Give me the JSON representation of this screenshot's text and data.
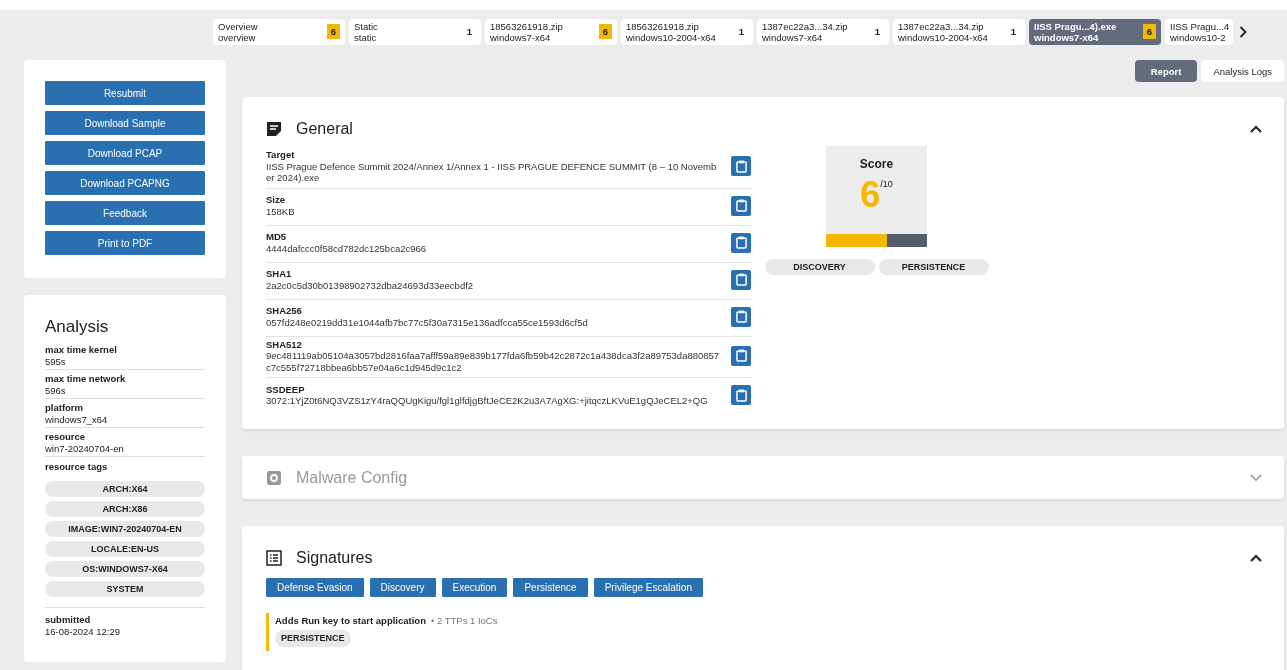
{
  "tabs": [
    {
      "title": "Overview",
      "subtitle": "overview",
      "count": "6",
      "kind": "score",
      "selected": false
    },
    {
      "title": "Static",
      "subtitle": "static",
      "count": "1",
      "kind": "plain",
      "selected": false
    },
    {
      "title": "18563261918.zip",
      "subtitle": "windows7-x64",
      "count": "6",
      "kind": "score",
      "selected": false
    },
    {
      "title": "18563261918.zip",
      "subtitle": "windows10-2004-x64",
      "count": "1",
      "kind": "plain",
      "selected": false
    },
    {
      "title": "1387ec22a3...34.zip",
      "subtitle": "windows7-x64",
      "count": "1",
      "kind": "plain",
      "selected": false
    },
    {
      "title": "1387ec22a3...34.zip",
      "subtitle": "windows10-2004-x64",
      "count": "1",
      "kind": "plain",
      "selected": false
    },
    {
      "title": "IISS Pragu...4).exe",
      "subtitle": "windows7-x64",
      "count": "6",
      "kind": "score",
      "selected": true
    },
    {
      "title": "IISS Pragu...4",
      "subtitle": "windows10-2",
      "selected": false
    }
  ],
  "view_buttons": [
    {
      "label": "Report",
      "selected": true
    },
    {
      "label": "Analysis Logs",
      "selected": false
    }
  ],
  "actions": [
    "Resubmit",
    "Download Sample",
    "Download PCAP",
    "Download PCAPNG",
    "Feedback",
    "Print to PDF"
  ],
  "analysis": {
    "title": "Analysis",
    "fields": [
      {
        "label": "max time kernel",
        "value": "595s"
      },
      {
        "label": "max time network",
        "value": "596s"
      },
      {
        "label": "platform",
        "value": "windows7_x64"
      },
      {
        "label": "resource",
        "value": "win7-20240704-en"
      }
    ],
    "tags_label": "resource tags",
    "tags": [
      "ARCH:X64",
      "ARCH:X86",
      "IMAGE:WIN7-20240704-EN",
      "LOCALE:EN-US",
      "OS:WINDOWS7-X64",
      "SYSTEM"
    ],
    "submitted": {
      "label": "submitted",
      "value": "16-08-2024 12:29"
    }
  },
  "general": {
    "title": "General",
    "expanded": true,
    "fields": [
      {
        "label": "Target",
        "value": "IISS Prague Defence Summit 2024/Annex 1/Annex 1 - IISS PRAGUE DEFENCE SUMMIT (8 – 10 November 2024).exe"
      },
      {
        "label": "Size",
        "value": "158KB"
      },
      {
        "label": "MD5",
        "value": "4444dafccc0f58cd782dc125bca2c966"
      },
      {
        "label": "SHA1",
        "value": "2a2c0c5d30b01398902732dba24693d33eecbdf2"
      },
      {
        "label": "SHA256",
        "value": "057fd248e0219dd31e1044afb7bc77c5f30a7315e136adfcca55ce1593d6cf5d"
      },
      {
        "label": "SHA512",
        "value": "9ec481119ab05104a3057bd2816faa7afff59a89e839b177fda6fb59b42c2872c1a438dca3f2a89753da880857c7c555f72718bbea6bb57e04a6c1d945d9c1c2"
      },
      {
        "label": "SSDEEP",
        "value": "3072:1YjZ0t6NQ3VZS1zY4raQQUgKigu/fgl1glfdjgBftJeCE2K2u3A7AgXG:+jitqczLKVuE1gQJeCEL2+QG"
      }
    ],
    "score": {
      "title": "Score",
      "value": "6",
      "max": "/10",
      "level": 0.6
    },
    "score_tags": [
      "DISCOVERY",
      "PERSISTENCE"
    ]
  },
  "malware_config": {
    "title": "Malware Config",
    "expanded": false,
    "disabled": true
  },
  "signatures": {
    "title": "Signatures",
    "expanded": true,
    "filters": [
      "Defense Evasion",
      "Discovery",
      "Execution",
      "Persistence",
      "Privilege Escalation"
    ],
    "items": [
      {
        "title": "Adds Run key to start application",
        "meta": "• 2 TTPs 1 IoCs",
        "color": "#f5b800",
        "tags": [
          "PERSISTENCE"
        ]
      }
    ]
  }
}
